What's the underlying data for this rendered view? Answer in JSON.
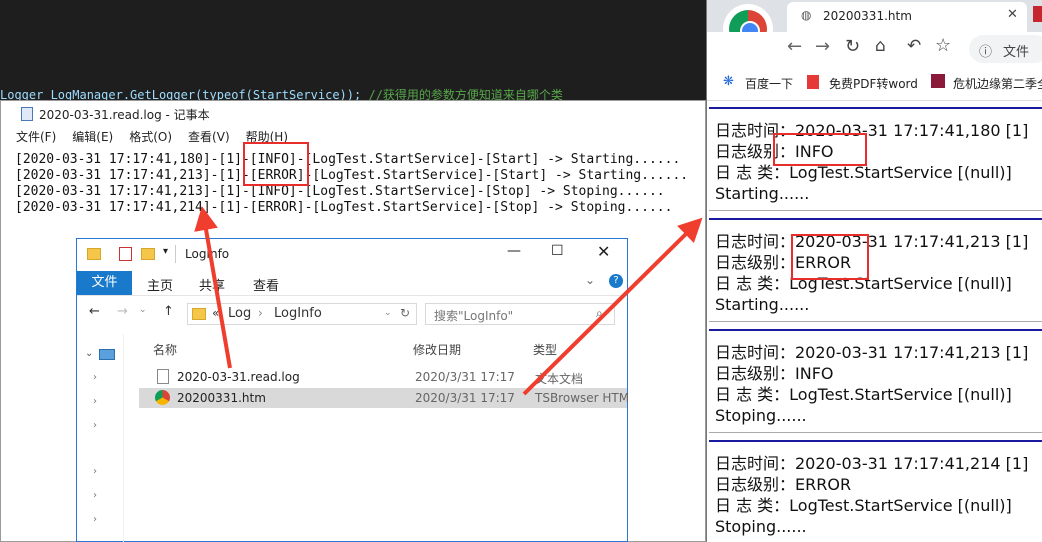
{
  "editor": {
    "code_text": "Logger LogManager.GetLogger(typeof(StartService));",
    "comment_text": "//获得用的参数方便知道来自哪个类"
  },
  "notepad": {
    "title": "2020-03-31.read.log - 记事本",
    "menu": [
      "文件(F)",
      "编辑(E)",
      "格式(O)",
      "查看(V)",
      "帮助(H)"
    ],
    "lines": [
      "[2020-03-31 17:17:41,180]-[1]-[INFO]-[LogTest.StartService]-[Start] -> Starting......",
      "[2020-03-31 17:17:41,213]-[1]-[ERROR]-[LogTest.StartService]-[Start] -> Starting......",
      "[2020-03-31 17:17:41,213]-[1]-[INFO]-[LogTest.StartService]-[Stop] -> Stoping......",
      "[2020-03-31 17:17:41,214]-[1]-[ERROR]-[LogTest.StartService]-[Stop] -> Stoping......"
    ]
  },
  "explorer": {
    "title": "LogInfo",
    "ribbon_tabs": [
      "文件",
      "主页",
      "共享",
      "查看"
    ],
    "breadcrumb": [
      "«",
      "Log",
      "›",
      "LogInfo"
    ],
    "search_placeholder": "搜索\"LogInfo\"",
    "columns": [
      "名称",
      "修改日期",
      "类型"
    ],
    "files": [
      {
        "name": "2020-03-31.read.log",
        "date": "2020/3/31 17:17",
        "type": "文本文档"
      },
      {
        "name": "20200331.htm",
        "date": "2020/3/31 17:17",
        "type": "TSBrowser HTM"
      }
    ]
  },
  "browser": {
    "tab_title": "20200331.htm",
    "address_label": "文件",
    "bookmarks": [
      "百度一下",
      "免费PDF转word",
      "危机边缘第二季全"
    ],
    "entries": [
      {
        "time": "日志时间：2020-03-31 17:17:41,180 [1]",
        "level_prefix": "日志级别：",
        "level": "INFO",
        "cls": "日 志 类：LogTest.StartService [(null)]",
        "msg": "Starting......"
      },
      {
        "time": "日志时间：2020-03-31 17:17:41,213 [1]",
        "level_prefix": "日志级别：",
        "level": "ERROR",
        "cls": "日 志 类：LogTest.StartService [(null)]",
        "msg": "Starting......"
      },
      {
        "time": "日志时间：2020-03-31 17:17:41,213 [1]",
        "level_prefix": "日志级别：",
        "level": "INFO",
        "cls": "日 志 类：LogTest.StartService [(null)]",
        "msg": "Stoping......"
      },
      {
        "time": "日志时间：2020-03-31 17:17:41,214 [1]",
        "level_prefix": "日志级别：",
        "level": "ERROR",
        "cls": "日 志 类：LogTest.StartService [(null)]",
        "msg": "Stoping......"
      }
    ]
  },
  "colors": {
    "highlight": "#e82d2d",
    "arrow": "#ef3d2e",
    "separator": "#1a1aa0",
    "ribbon_file": "#1979ca"
  }
}
